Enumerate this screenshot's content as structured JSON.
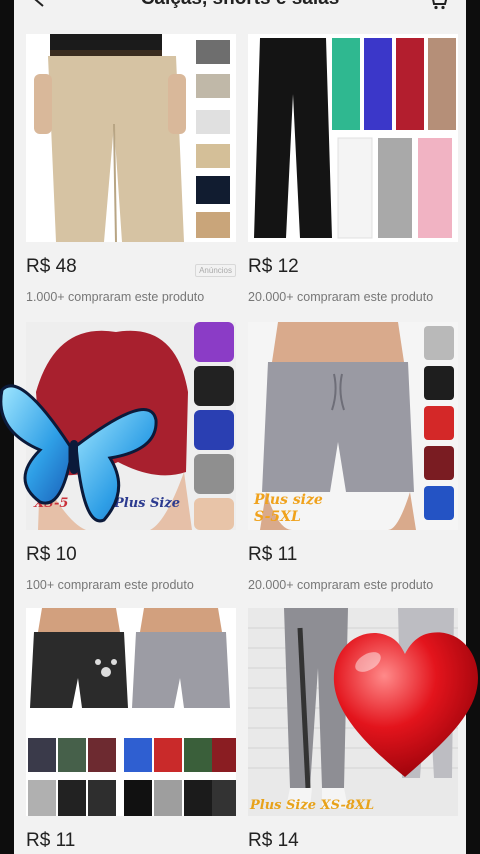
{
  "header": {
    "title": "Calças, shorts e saias"
  },
  "products": [
    {
      "price": "R$ 48",
      "sold": "1.000+ compraram este produto",
      "ad_label": "Anúncios"
    },
    {
      "price": "R$ 12",
      "sold": "20.000+ compraram este produto"
    },
    {
      "price": "R$ 10",
      "sold": "100+ compraram este produto",
      "overlay_left": "XS-5",
      "overlay_right": "Plus Size"
    },
    {
      "price": "R$ 11",
      "sold": "20.000+ compraram este produto",
      "overlay": "Plus size S-5XL"
    },
    {
      "price": "R$ 11"
    },
    {
      "price": "R$ 14",
      "overlay": "Plus Size XS-8XL"
    }
  ],
  "colors": {
    "background": "#f2f2f2",
    "text": "#222222",
    "muted": "#777777",
    "heart": "#e3141c",
    "butterfly": "#2fa8e8"
  }
}
